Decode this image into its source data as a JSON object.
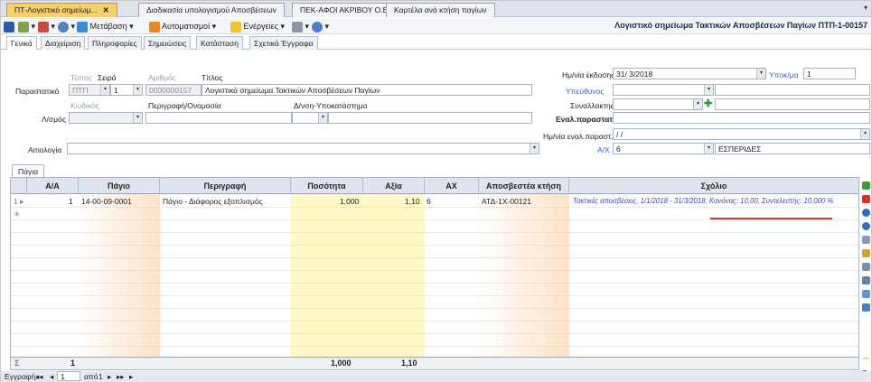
{
  "tabs": [
    {
      "label": "ΠΤ-Λογιστικό σημείωμ...",
      "active": true
    },
    {
      "label": "Διαδικασία υπολογισμού Αποσβέσεων",
      "active": false
    },
    {
      "label": "ΠΕΚ-ΑΦΟΙ ΑΚΡΙΒΟΥ Ο.Ε",
      "active": false
    },
    {
      "label": "Καρτέλα ανά κτήση παγίων",
      "active": false
    }
  ],
  "toolbar": {
    "metavasi": "Μετάβαση",
    "automatismoi": "Αυτοματισμοί",
    "energeies": "Ενέργειες",
    "title": "Λογιστικό σημείωμα Τακτικών Αποσβέσεων Παγίων ΠΤΠ-1-00157"
  },
  "subtabs": [
    "Γενικά",
    "Διαχείριση",
    "Πληροφορίες",
    "Σημειώσεις",
    "Κατάσταση",
    "Σχετικά Έγγραφα"
  ],
  "form": {
    "typos_label": "Τύπος",
    "seira_label": "Σειρά",
    "arithmos_label": "Αριθμός",
    "titlos_label": "Τίτλος",
    "parastatiko_label": "Παραστατικό",
    "typos_value": "ΠΤΠ",
    "seira_value": "1",
    "arithmos_value": "0000000157",
    "titlos_value": "Λογιστικό σημείωμα Τακτικών Αποσβέσεων Παγίων",
    "kodikos_label": "Κωδικός",
    "perigrafi_label": "Περιγραφή/Ονομασία",
    "dnsi_label": "Δ/νση-Υποκατάστημα",
    "logariasmos_label": "Λ/σμός",
    "aitiologia_label": "Αιτιολογία",
    "date_label": "Ημ/νία έκδοσης",
    "date_value": "31/ 3/2018",
    "ypokma_label": "Υποκ/μα",
    "ypokma_value": "1",
    "ypeythynos_label": "Υπεύθυνος",
    "synal_label": "Συναλλακτης",
    "enal_label": "Εναλ.παραστατικό",
    "enal_date_label": "Ημ/νία εναλ.παραστ.",
    "enal_date_value": "  /  /",
    "ax_label": "Α/Χ",
    "ax_value": "6",
    "ax_name": "ΕΣΠΕΡΙΔΕΣ"
  },
  "grid": {
    "tab": "Πάγια",
    "headers": [
      "Α/Α",
      "Πάγιο",
      "Περιγραφή",
      "Ποσότητα",
      "Αξία",
      "ΑΧ",
      "Αποσβεστέα κτήση",
      "Σχόλιο"
    ],
    "row": {
      "aa": "1",
      "pagio": "14-00-09-0001",
      "perigrafi": "Πάγιο - Διάφορος εξοπλισμός",
      "posotita": "1,000",
      "axia": "1,10",
      "ax": "6",
      "ktisi": "ΑΤΔ-1Χ-00121",
      "sxolio": "Τακτικές αποσβέσεις, 1/1/2018 - 31/3/2018, Κανόνας: 10,00, Συντελεστής: 10,000 %"
    },
    "footer": {
      "sigma": "Σ",
      "aa": "1",
      "posotita": "1,000",
      "axia": "1,10"
    }
  },
  "nav": {
    "label": "Εγγραφή:",
    "current": "1",
    "of": "από",
    "total": "1"
  },
  "colors": {
    "active_tab": "#f6cf6e",
    "pagio_col": "#fde2c6",
    "posotita_col": "#fff8c6",
    "axia_col": "#fff8c6",
    "ktisi_col": "#fde2c6",
    "comment_text": "#3a48b8",
    "underline": "#d23b2f"
  }
}
